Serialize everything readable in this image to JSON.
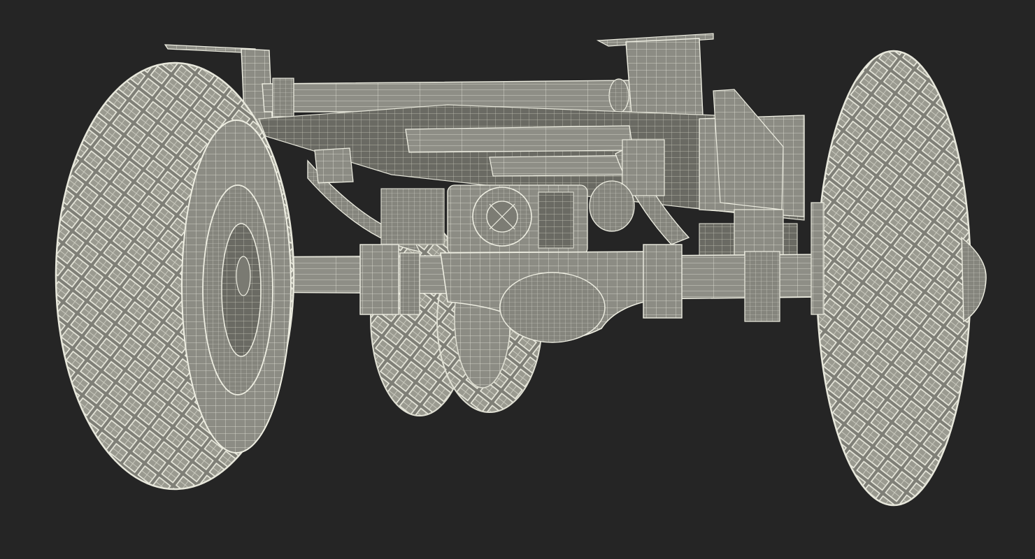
{
  "scene": {
    "subject": "truck-chassis-wireframe-render",
    "background_color": "#252525",
    "surface_color": "#8a8a80",
    "wire_color": "#e8e8dc",
    "shadow_color": "#4c4c46"
  }
}
